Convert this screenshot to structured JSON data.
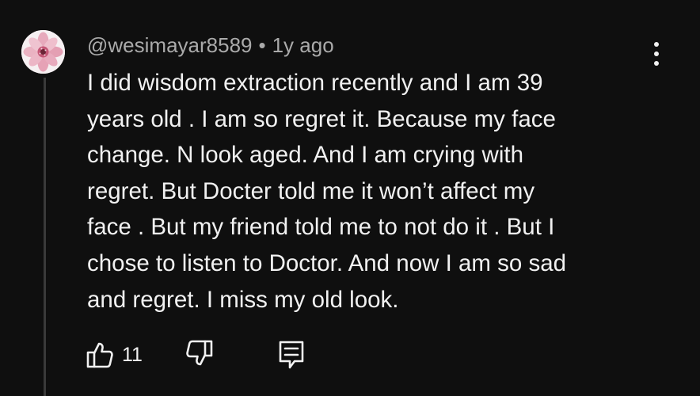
{
  "comment": {
    "author": "@wesimayar8589",
    "separator": "•",
    "time": "1y ago",
    "lines": [
      "I did wisdom extraction recently and I am 39",
      "years old . I am so regret it. Because my face",
      "change. N look aged. And I am crying with",
      "regret. But Docter told me it won’t affect my",
      "face . But my friend told me to not do it . But I",
      "chose to listen to Doctor. And now I am so sad",
      "and regret. I miss my old look."
    ],
    "like_count": "11"
  },
  "icons": {
    "avatar": "pink-flower-avatar",
    "menu": "more-vertical-icon",
    "like": "thumbs-up-icon",
    "dislike": "thumbs-down-icon",
    "reply": "reply-comment-icon"
  },
  "colors": {
    "background": "#0f0f0f",
    "text": "#f1f1f1",
    "meta": "#aaaaaa",
    "thread_line": "#3a3a3a"
  }
}
